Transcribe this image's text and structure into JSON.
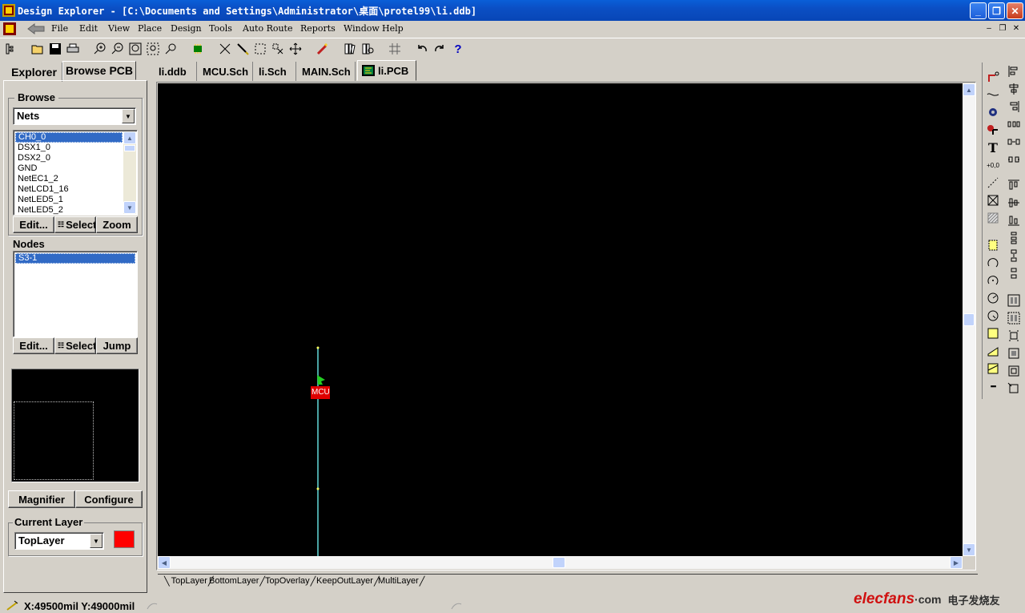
{
  "window": {
    "title": "Design Explorer - [C:\\Documents and Settings\\Administrator\\桌面\\protel99\\li.ddb]",
    "controls": {
      "minimize": "_",
      "restore": "❐",
      "close": "✕"
    },
    "mdi_controls": {
      "minimize": "–",
      "restore": "❐",
      "close": "✕"
    }
  },
  "menu": {
    "items": [
      "File",
      "Edit",
      "View",
      "Place",
      "Design",
      "Tools",
      "Auto Route",
      "Reports",
      "Window",
      "Help"
    ]
  },
  "left_panel": {
    "tabs": [
      "Explorer",
      "Browse PCB"
    ],
    "active_tab": "Browse PCB",
    "browse": {
      "group_label": "Browse",
      "type_selected": "Nets",
      "nets": [
        "CH0_0",
        "DSX1_0",
        "DSX2_0",
        "GND",
        "NetEC1_2",
        "NetLCD1_16",
        "NetLED5_1",
        "NetLED5_2"
      ],
      "selected_net": "CH0_0",
      "buttons": [
        "Edit...",
        "Select",
        "Zoom"
      ]
    },
    "nodes": {
      "label": "Nodes",
      "items": [
        "S3-1"
      ],
      "buttons": [
        "Edit...",
        "Select",
        "Jump"
      ]
    },
    "magnifier_buttons": [
      "Magnifier",
      "Configure"
    ],
    "current_layer": {
      "label": "Current Layer",
      "value": "TopLayer",
      "color": "#ff0000"
    }
  },
  "document_tabs": [
    "li.ddb",
    "MCU.Sch",
    "li.Sch",
    "MAIN.Sch",
    "li.PCB"
  ],
  "active_document": "li.PCB",
  "canvas": {
    "background": "#000000",
    "component_label": "MCU",
    "trace_color": "#4aa3a3",
    "component_color": "#e00000",
    "marker_color": "#22cc22"
  },
  "layer_tabs": [
    "TopLayer",
    "BottomLayer",
    "TopOverlay",
    "KeepOutLayer",
    "MultiLayer"
  ],
  "status": {
    "coordinates": "X:49500mil Y:49000mil"
  },
  "watermark": {
    "text_en": "elecfans",
    "text_dot_com": "·com",
    "text_cn": "电子发烧友"
  }
}
